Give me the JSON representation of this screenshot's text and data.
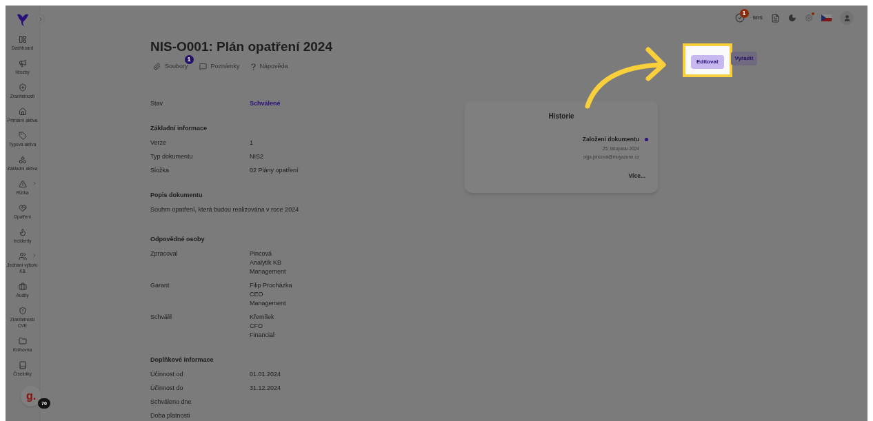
{
  "sidebar": {
    "items": [
      {
        "label": "Dashboard",
        "expandable": false
      },
      {
        "label": "Hrozby",
        "expandable": false
      },
      {
        "label": "Zranitelnosti",
        "expandable": false
      },
      {
        "label": "Primární aktiva",
        "expandable": false
      },
      {
        "label": "Typová aktiva",
        "expandable": false
      },
      {
        "label": "Základní aktiva",
        "expandable": false
      },
      {
        "label": "Rizika",
        "expandable": true
      },
      {
        "label": "Opatření",
        "expandable": false
      },
      {
        "label": "Incidenty",
        "expandable": false
      },
      {
        "label": "Jednání výboru KB",
        "expandable": true
      },
      {
        "label": "Audity",
        "expandable": false
      },
      {
        "label": "Zranitelnosti CVE",
        "expandable": false
      },
      {
        "label": "Knihovna",
        "expandable": false
      },
      {
        "label": "Číselníky",
        "expandable": false
      }
    ]
  },
  "chat_widget": {
    "letter": "g.",
    "badge": "70"
  },
  "header": {
    "tasks_badge": "1",
    "sds": "SDS"
  },
  "title": "NIS-O001: Plán opatření 2024",
  "tabs": [
    {
      "label": "Soubory",
      "badge": "1"
    },
    {
      "label": "Poznámky"
    },
    {
      "label": "Nápověda"
    }
  ],
  "actions": [
    {
      "label": "Editovat",
      "highlighted": true
    },
    {
      "label": "Vyřadit",
      "highlighted": false
    }
  ],
  "details": [
    {
      "kind": "status",
      "label": "Stav",
      "values": [
        "Schválené"
      ]
    },
    {
      "kind": "heading",
      "label": "Základní informace"
    },
    {
      "kind": "field",
      "label": "Verze",
      "values": [
        "1"
      ]
    },
    {
      "kind": "field",
      "label": "Typ dokumentu",
      "values": [
        "NIS2"
      ]
    },
    {
      "kind": "field",
      "label": "Složka",
      "values": [
        "02 Plány opatření"
      ]
    },
    {
      "kind": "heading",
      "label": "Popis dokumentu"
    },
    {
      "kind": "text",
      "label": "Souhrn opatření, která budou realizována v roce 2024"
    },
    {
      "kind": "heading",
      "label": "Odpovědné osoby"
    },
    {
      "kind": "field",
      "label": "Zpracoval",
      "values": [
        "Pincová",
        "Analytik KB",
        "Management"
      ]
    },
    {
      "kind": "field",
      "label": "Garant",
      "values": [
        "Filip Procházka",
        "CEO",
        "Management"
      ]
    },
    {
      "kind": "field",
      "label": "Schválil",
      "values": [
        "Křemílek",
        "CFO",
        "Financial"
      ]
    },
    {
      "kind": "heading",
      "label": "Doplňkové informace"
    },
    {
      "kind": "field",
      "label": "Účinnost od",
      "values": [
        "01.01.2024"
      ]
    },
    {
      "kind": "field",
      "label": "Účinnost do",
      "values": [
        "31.12.2024"
      ]
    },
    {
      "kind": "field",
      "label": "Schváleno dne"
    },
    {
      "kind": "field",
      "label": "Doba platnosti"
    }
  ],
  "history": {
    "title": "Historie",
    "entries": [
      {
        "event": "Založení dokumentu",
        "date": "25. listopadu 2024",
        "user": "olga.pincova@moyazone.cz",
        "color": "#2a0f7a"
      }
    ],
    "more": "Více..."
  }
}
